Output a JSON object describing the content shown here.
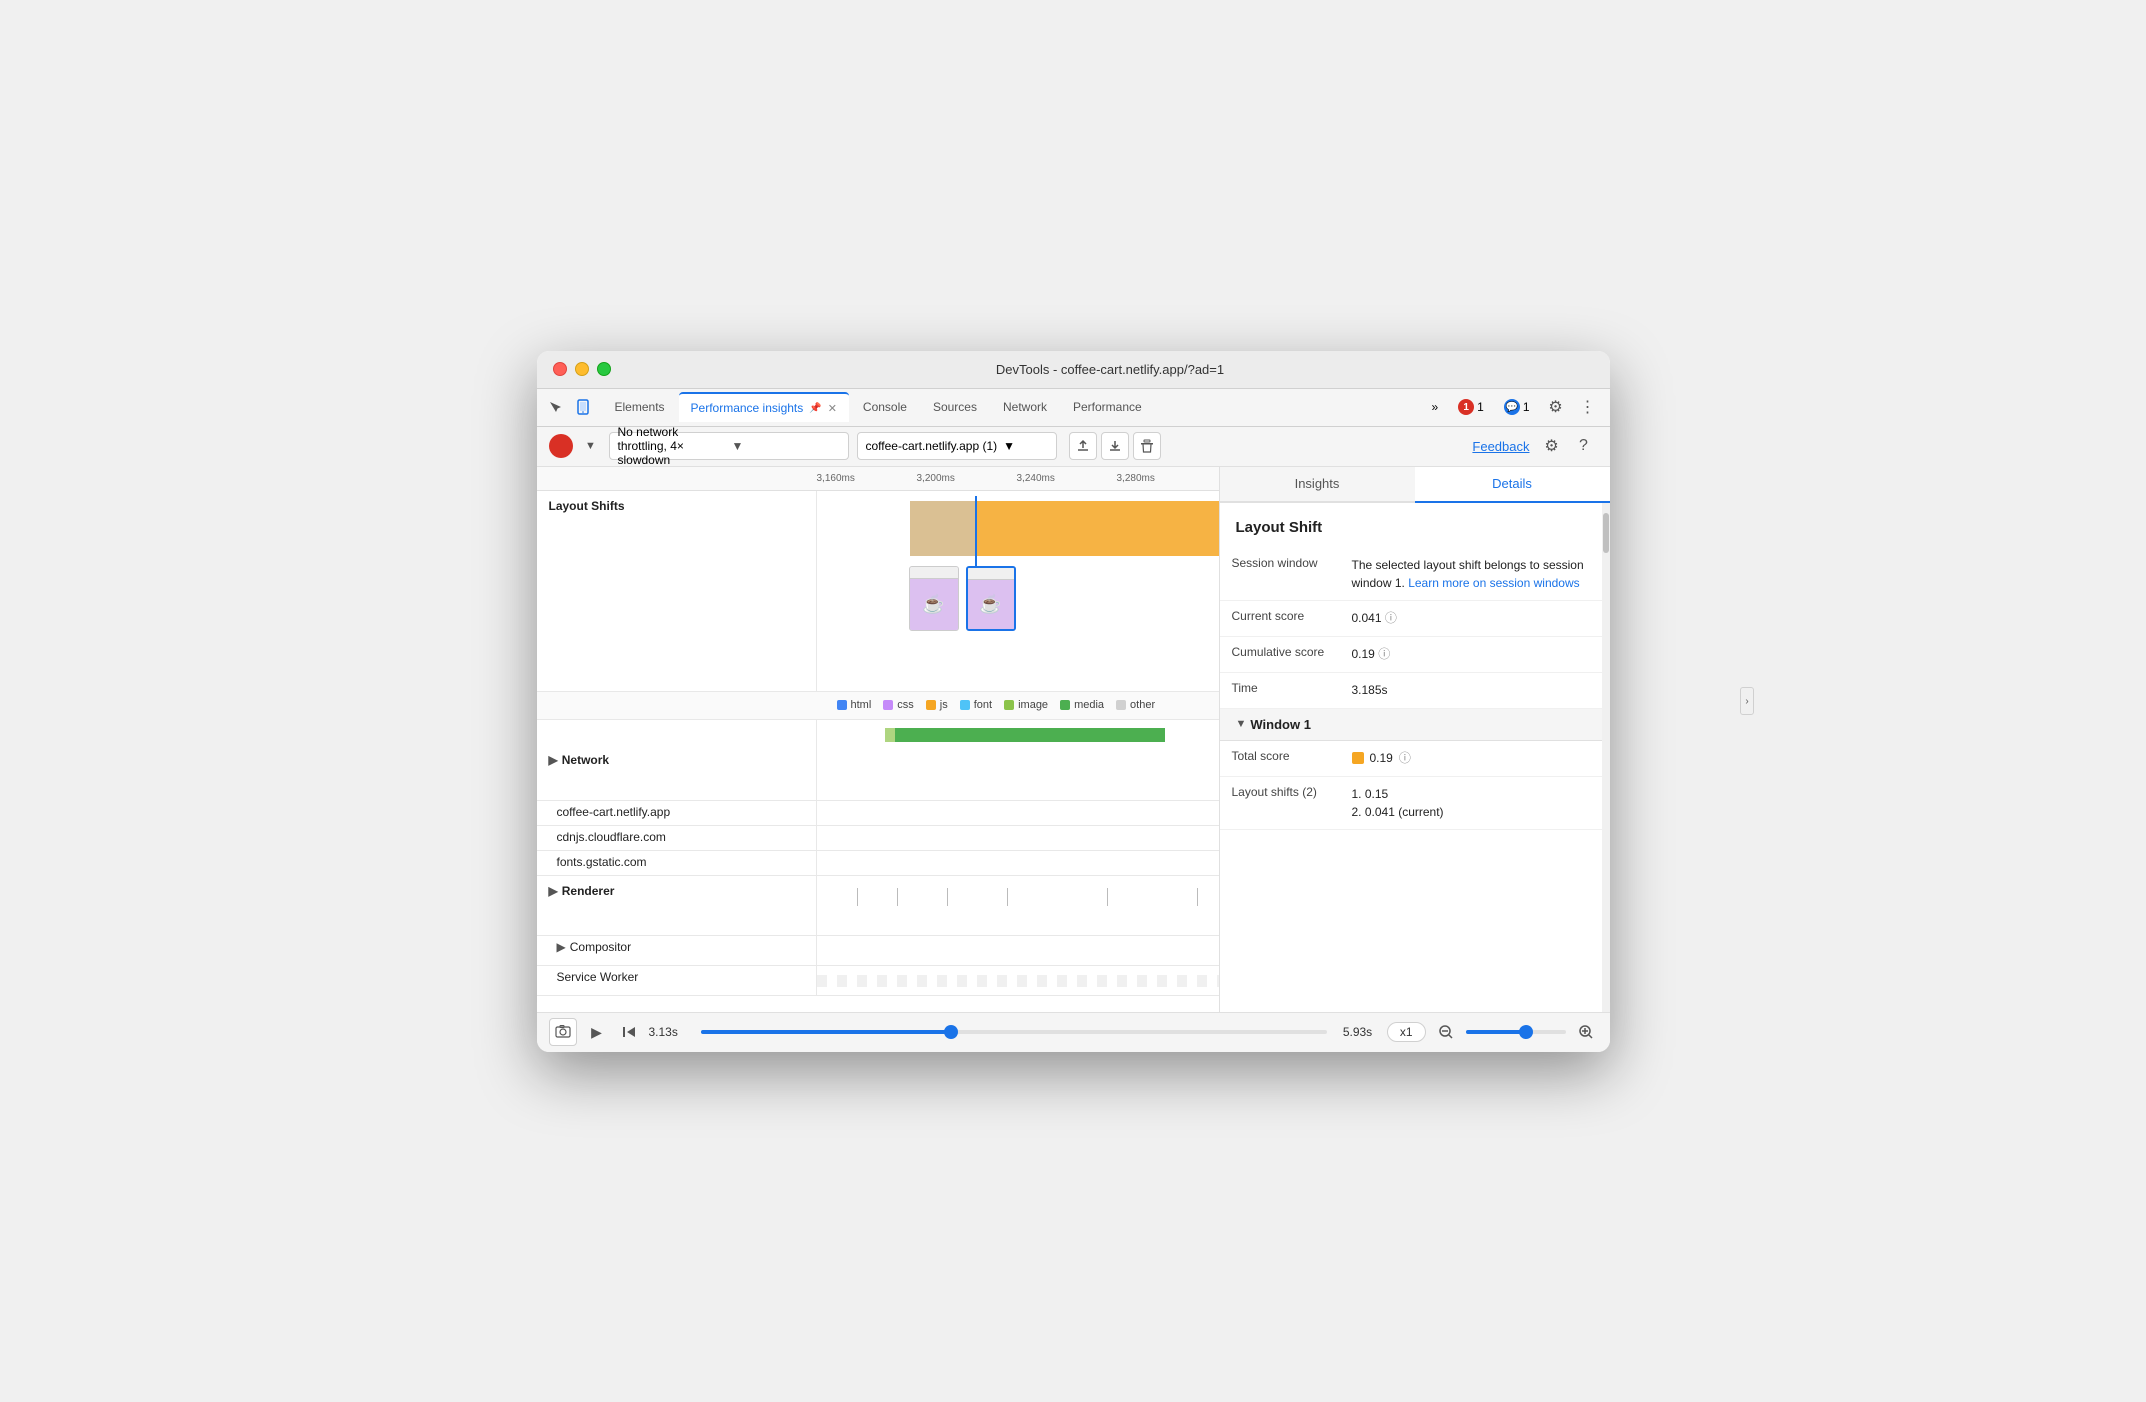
{
  "window": {
    "title": "DevTools - coffee-cart.netlify.app/?ad=1"
  },
  "tabs": {
    "items": [
      {
        "label": "Elements",
        "active": false
      },
      {
        "label": "Performance insights",
        "active": true,
        "pinned": true
      },
      {
        "label": "Console",
        "active": false
      },
      {
        "label": "Sources",
        "active": false
      },
      {
        "label": "Network",
        "active": false
      },
      {
        "label": "Performance",
        "active": false
      }
    ],
    "overflow": "»",
    "error_count": "1",
    "message_count": "1"
  },
  "toolbar": {
    "throttle_label": "No network throttling, 4× slowdown",
    "url_label": "coffee-cart.netlify.app (1)",
    "feedback_label": "Feedback",
    "upload_icon": "↑",
    "download_icon": "↓",
    "delete_icon": "🗑"
  },
  "timeline": {
    "ruler": {
      "marks": [
        "3,160ms",
        "3,200ms",
        "3,240ms",
        "3,280ms"
      ]
    },
    "sections": {
      "layout_shifts": {
        "label": "Layout Shifts"
      },
      "network": {
        "label": "Network",
        "rows": [
          "coffee-cart.netlify.app",
          "cdnjs.cloudflare.com",
          "fonts.gstatic.com"
        ]
      },
      "renderer": {
        "label": "Renderer"
      },
      "compositor": {
        "label": "Compositor"
      },
      "service_worker": {
        "label": "Service Worker"
      }
    },
    "legend": {
      "items": [
        {
          "label": "html",
          "color": "#4285f4"
        },
        {
          "label": "css",
          "color": "#c58af9"
        },
        {
          "label": "js",
          "color": "#f5a623"
        },
        {
          "label": "font",
          "color": "#4fc3f7"
        },
        {
          "label": "image",
          "color": "#8bc34a"
        },
        {
          "label": "media",
          "color": "#4caf50"
        },
        {
          "label": "other",
          "color": "#d0d0d0"
        }
      ]
    }
  },
  "right_panel": {
    "tabs": [
      "Insights",
      "Details"
    ],
    "active_tab": "Details",
    "detail": {
      "title": "Layout Shift",
      "rows": [
        {
          "key": "Session window",
          "value_text": "The selected layout shift belongs to session window 1. ",
          "link_text": "Learn more on session windows",
          "link_href": "#"
        },
        {
          "key": "Current score",
          "value": "0.041"
        },
        {
          "key": "Cumulative score",
          "value": "0.19"
        },
        {
          "key": "Time",
          "value": "3.185s"
        }
      ],
      "window_section": {
        "label": "Window 1",
        "total_score_label": "Total score",
        "total_score_value": "0.19",
        "layout_shifts_label": "Layout shifts (2)",
        "shift1": "1. 0.15",
        "shift2": "2. 0.041 (current)"
      }
    }
  },
  "bottom_bar": {
    "start_time": "3.13s",
    "end_time": "5.93s",
    "zoom_level": "x1"
  },
  "colors": {
    "blue": "#1a73e8",
    "orange": "#f5a623",
    "green": "#4caf50",
    "light_green": "#8bc34a",
    "purple": "#c58af9",
    "gray": "#d0d0d0"
  }
}
